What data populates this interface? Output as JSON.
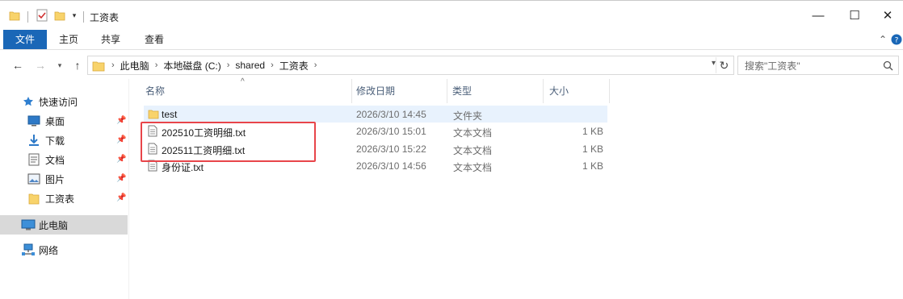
{
  "window": {
    "title": "工资表",
    "controls": {
      "minimize": "—",
      "maximize": "☐",
      "close": "✕"
    }
  },
  "ribbon": {
    "tabs": [
      {
        "label": "文件"
      },
      {
        "label": "主页"
      },
      {
        "label": "共享"
      },
      {
        "label": "查看"
      }
    ],
    "collapse_glyph": "⌃"
  },
  "address": {
    "crumbs": [
      "此电脑",
      "本地磁盘 (C:)",
      "shared",
      "工资表"
    ],
    "search_placeholder": "搜索\"工资表\""
  },
  "sidebar": {
    "quick_access": "快速访问",
    "pinned": [
      {
        "label": "桌面",
        "icon": "desktop-icon"
      },
      {
        "label": "下载",
        "icon": "download-icon"
      },
      {
        "label": "文档",
        "icon": "document-icon"
      },
      {
        "label": "图片",
        "icon": "picture-icon"
      },
      {
        "label": "工资表",
        "icon": "folder-icon"
      }
    ],
    "this_pc": "此电脑",
    "network": "网络"
  },
  "columns": {
    "name": "名称",
    "date": "修改日期",
    "type": "类型",
    "size": "大小"
  },
  "files": [
    {
      "name": "test",
      "date": "2026/3/10 14:45",
      "type": "文件夹",
      "size": "",
      "icon": "folder-icon"
    },
    {
      "name": "202510工资明细.txt",
      "date": "2026/3/10 15:01",
      "type": "文本文档",
      "size": "1 KB",
      "icon": "text-file-icon"
    },
    {
      "name": "202511工资明细.txt",
      "date": "2026/3/10 15:22",
      "type": "文本文档",
      "size": "1 KB",
      "icon": "text-file-icon"
    },
    {
      "name": "身份证.txt",
      "date": "2026/3/10 14:56",
      "type": "文本文档",
      "size": "1 KB",
      "icon": "text-file-icon"
    }
  ],
  "colors": {
    "accent": "#1a67b7",
    "selection": "#e8f2fd",
    "highlight_box": "#e8454a",
    "folder": "#f8d36b"
  }
}
